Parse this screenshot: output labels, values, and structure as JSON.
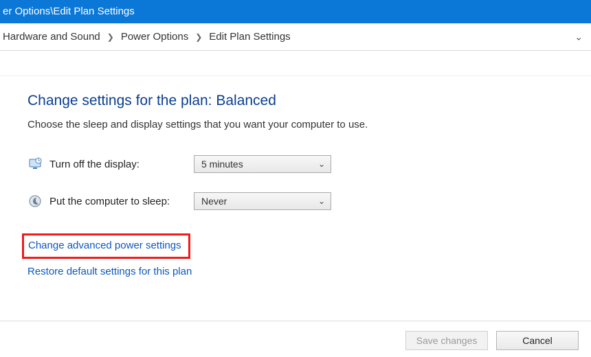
{
  "titlebar": "er Options\\Edit Plan Settings",
  "breadcrumb": {
    "items": [
      "Hardware and Sound",
      "Power Options",
      "Edit Plan Settings"
    ]
  },
  "heading": "Change settings for the plan: Balanced",
  "subtext": "Choose the sleep and display settings that you want your computer to use.",
  "rows": {
    "display": {
      "label": "Turn off the display:",
      "value": "5 minutes"
    },
    "sleep": {
      "label": "Put the computer to sleep:",
      "value": "Never"
    }
  },
  "links": {
    "advanced": "Change advanced power settings",
    "restore": "Restore default settings for this plan"
  },
  "buttons": {
    "save": "Save changes",
    "cancel": "Cancel"
  }
}
